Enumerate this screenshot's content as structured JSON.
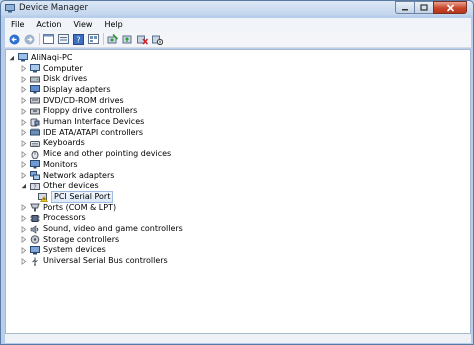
{
  "window": {
    "title": "Device Manager"
  },
  "menu": [
    "File",
    "Action",
    "View",
    "Help"
  ],
  "toolbar": [
    "back-icon",
    "forward-icon",
    "properties-pane-icon",
    "show-hide-icon",
    "help-icon",
    "view-icon",
    "scan-hardware-icon",
    "update-driver-icon",
    "uninstall-icon",
    "disable-icon"
  ],
  "tree": {
    "root": "AliNaqi-PC",
    "items": [
      {
        "label": "Computer",
        "icon": "computer-icon",
        "expanded": false
      },
      {
        "label": "Disk drives",
        "icon": "disk-icon",
        "expanded": false
      },
      {
        "label": "Display adapters",
        "icon": "display-icon",
        "expanded": false
      },
      {
        "label": "DVD/CD-ROM drives",
        "icon": "dvd-icon",
        "expanded": false
      },
      {
        "label": "Floppy drive controllers",
        "icon": "floppy-icon",
        "expanded": false
      },
      {
        "label": "Human Interface Devices",
        "icon": "hid-icon",
        "expanded": false
      },
      {
        "label": "IDE ATA/ATAPI controllers",
        "icon": "ide-icon",
        "expanded": false
      },
      {
        "label": "Keyboards",
        "icon": "keyboard-icon",
        "expanded": false
      },
      {
        "label": "Mice and other pointing devices",
        "icon": "mouse-icon",
        "expanded": false
      },
      {
        "label": "Monitors",
        "icon": "monitor-icon",
        "expanded": false
      },
      {
        "label": "Network adapters",
        "icon": "network-icon",
        "expanded": false
      },
      {
        "label": "Other devices",
        "icon": "other-devices-icon",
        "expanded": true
      },
      {
        "label": "PCI Serial Port",
        "icon": "warning-device-icon",
        "child": true,
        "selected": true
      },
      {
        "label": "Ports (COM & LPT)",
        "icon": "port-icon",
        "expanded": false
      },
      {
        "label": "Processors",
        "icon": "processor-icon",
        "expanded": false
      },
      {
        "label": "Sound, video and game controllers",
        "icon": "sound-icon",
        "expanded": false
      },
      {
        "label": "Storage controllers",
        "icon": "storage-icon",
        "expanded": false
      },
      {
        "label": "System devices",
        "icon": "system-icon",
        "expanded": false
      },
      {
        "label": "Universal Serial Bus controllers",
        "icon": "usb-icon",
        "expanded": false
      }
    ]
  },
  "colors": {
    "selection": "#dbe9f8",
    "close_button": "#c8452b",
    "title_bar": "#c3d6ee"
  }
}
